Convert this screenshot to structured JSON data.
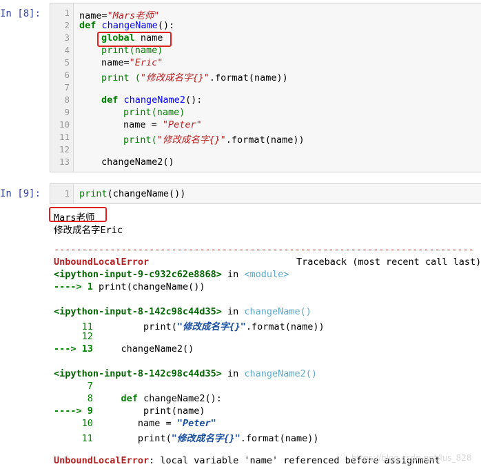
{
  "cell1": {
    "prompt": "In [8]:",
    "lines": [
      {
        "n": "1"
      },
      {
        "n": "2"
      },
      {
        "n": "3"
      },
      {
        "n": "4"
      },
      {
        "n": "5"
      },
      {
        "n": "6"
      },
      {
        "n": "7"
      },
      {
        "n": "8"
      },
      {
        "n": "9"
      },
      {
        "n": "10"
      },
      {
        "n": "11"
      },
      {
        "n": "12"
      },
      {
        "n": "13"
      }
    ],
    "code": {
      "l1_a": "name=",
      "l1_b": "\"Mars老师\"",
      "l2_kw": "def",
      "l2_fn": "changeName",
      "l2_rest": "():",
      "l3_kw": "global",
      "l3_rest": " name",
      "l4": "print(name)",
      "l5_a": "name=",
      "l5_b": "\"Eric\"",
      "l6_a": "print (",
      "l6_b": "\"修改成名字{}\"",
      "l6_c": ".format(name))",
      "l8_kw": "def",
      "l8_fn": "changeName2",
      "l8_rest": "():",
      "l9": "print(name)",
      "l10_a": "name = ",
      "l10_b": "\"Peter\"",
      "l11_a": "print(",
      "l11_b": "\"修改成名字{}\"",
      "l11_c": ".format(name))",
      "l13": "changeName2()"
    }
  },
  "cell2": {
    "prompt": "In [9]:",
    "line_no": "1",
    "code_a": "print",
    "code_b": "(changeName())"
  },
  "output": {
    "line1": "Mars老师",
    "line2": "修改成名字Eric",
    "dashes": "---------------------------------------------------------------------------",
    "error_name": "UnboundLocalError",
    "traceback_header": "Traceback (most recent call last)",
    "frame1_file": "<ipython-input-9-c932c62e8868>",
    "frame1_in": " in ",
    "frame1_func": "<module>",
    "frame1_arrow": "----> 1",
    "frame1_code_a": " print",
    "frame1_code_b": "(changeName())",
    "frame2_file": "<ipython-input-8-142c98c44d35>",
    "frame2_in": " in ",
    "frame2_func": "changeName",
    "frame2_paren": "()",
    "frame2_l11_no": "     11",
    "frame2_l11_a": "         print(",
    "frame2_l11_b": "\"修改成名字{}\"",
    "frame2_l11_c": ".format(name))",
    "frame2_l12_no": "     12",
    "frame2_arrow": "---> 13",
    "frame2_l13_code": "     changeName2()",
    "frame3_file": "<ipython-input-8-142c98c44d35>",
    "frame3_in": " in ",
    "frame3_func": "changeName2",
    "frame3_paren": "()",
    "frame3_l7_no": "      7",
    "frame3_l8_no": "      8",
    "frame3_l8_kw": "     def",
    "frame3_l8_rest": " changeName2():",
    "frame3_arrow": "----> 9",
    "frame3_l9_code": "         print(name)",
    "frame3_l10_no": "     10",
    "frame3_l10_a": "        name = ",
    "frame3_l10_b": "\"Peter\"",
    "frame3_l11_no": "     11",
    "frame3_l11_a": "        print(",
    "frame3_l11_b": "\"修改成名字{}\"",
    "frame3_l11_c": ".format(name))",
    "final_error_name": "UnboundLocalError",
    "final_error_msg": ": local variable 'name' referenced before assignment"
  },
  "watermark": "https://blog.csdn.net/lus_828",
  "colors": {
    "highlight_box": "#e0201c",
    "prompt": "#303f9f",
    "keyword": "#008000"
  }
}
